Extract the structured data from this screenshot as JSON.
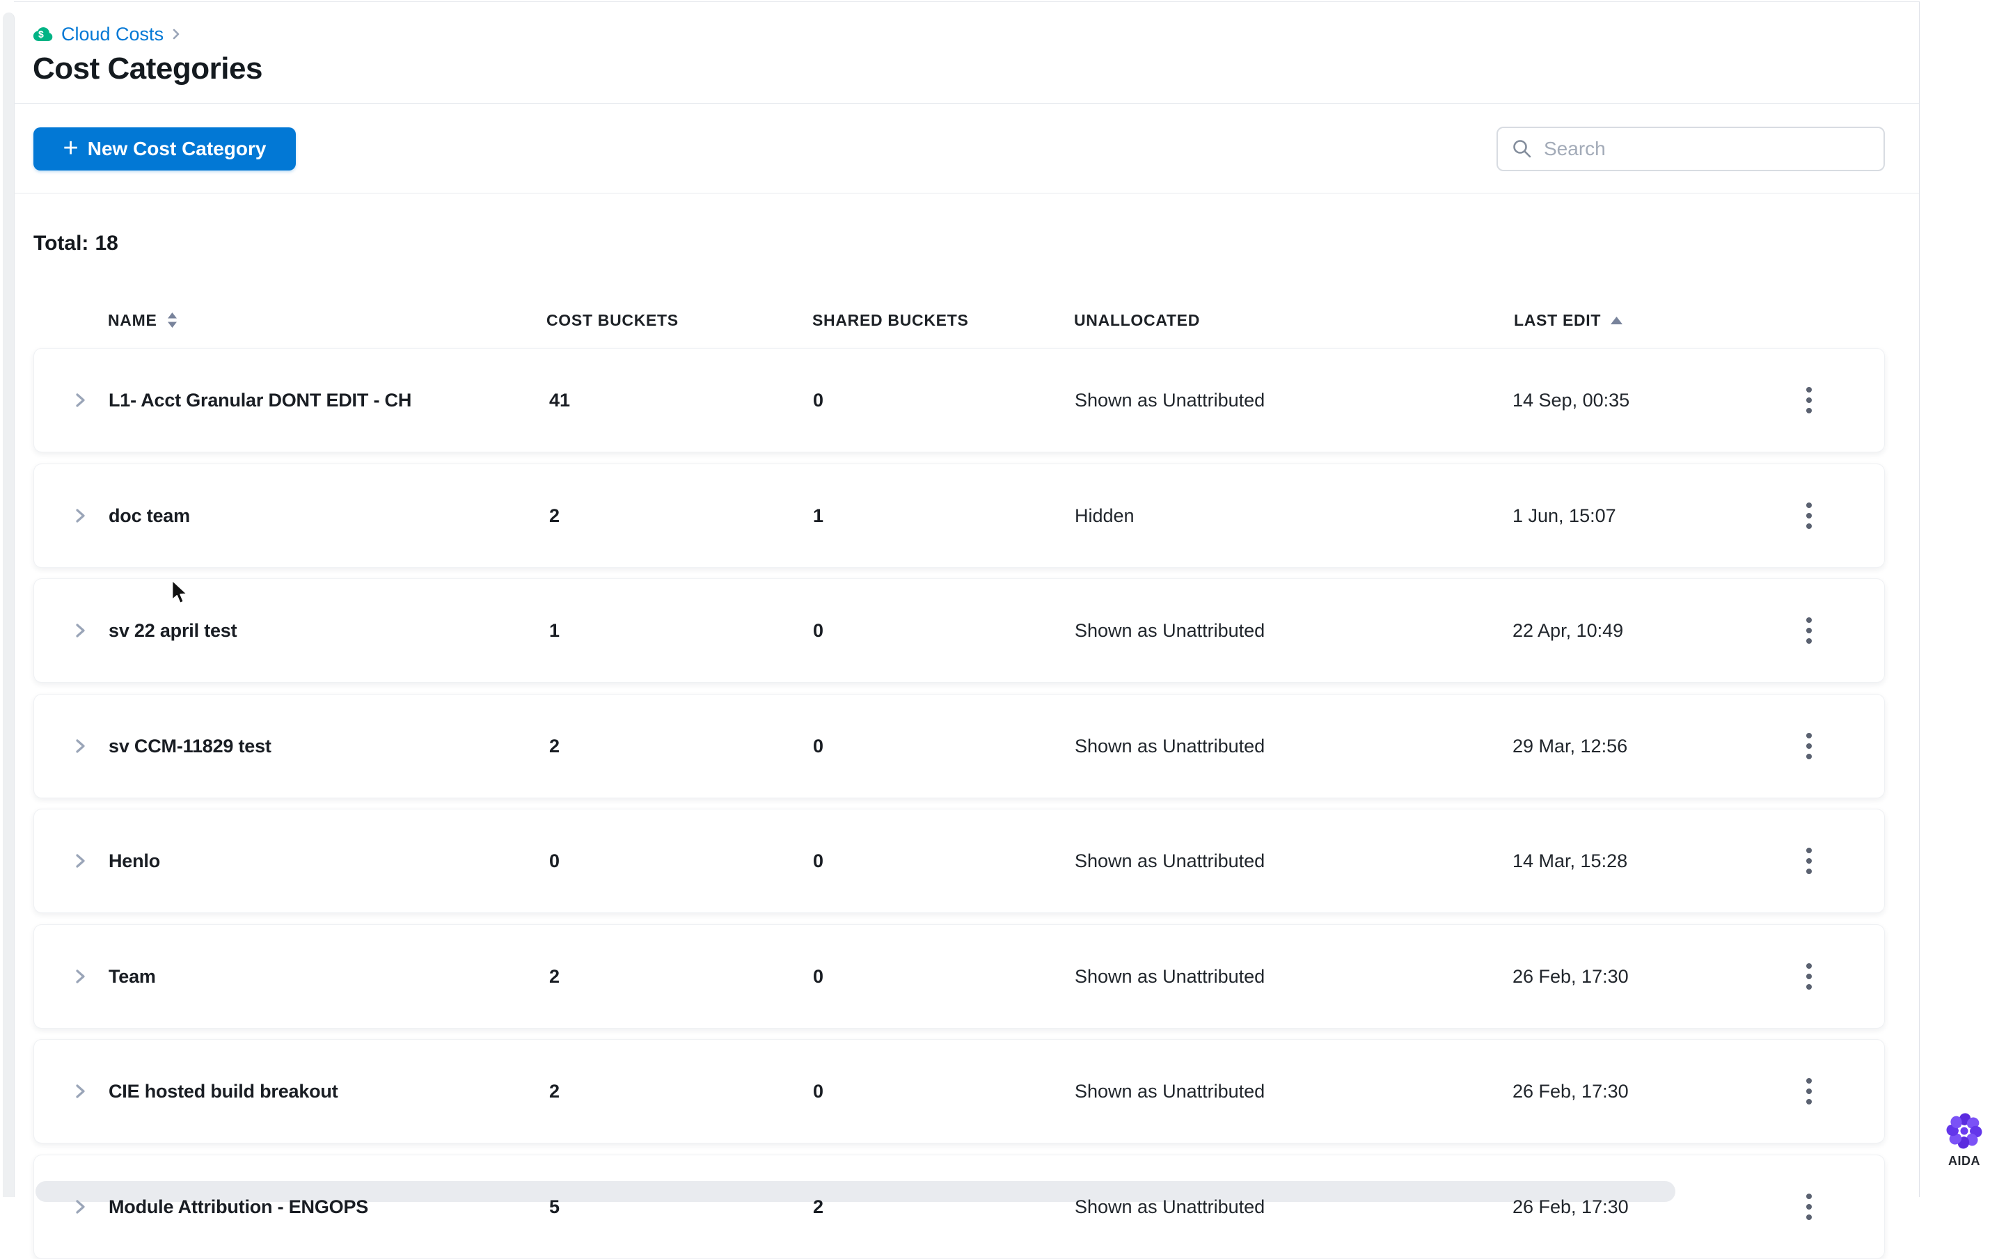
{
  "breadcrumb": {
    "module": "Cloud Costs"
  },
  "page": {
    "title": "Cost Categories",
    "total_label": "Total:",
    "total_count": "18"
  },
  "toolbar": {
    "new_button_plus": "+",
    "new_button_label": "New Cost Category",
    "search_placeholder": "Search",
    "search_value": ""
  },
  "table": {
    "columns": [
      {
        "label": "NAME",
        "sort": "both"
      },
      {
        "label": "COST BUCKETS",
        "sort": "none"
      },
      {
        "label": "SHARED BUCKETS",
        "sort": "none"
      },
      {
        "label": "UNALLOCATED",
        "sort": "none"
      },
      {
        "label": "LAST EDIT",
        "sort": "asc"
      }
    ],
    "rows": [
      {
        "name": "L1- Acct Granular DONT EDIT - CH",
        "cost_buckets": "41",
        "shared_buckets": "0",
        "unallocated": "Shown as Unattributed",
        "last_edit": "14 Sep, 00:35"
      },
      {
        "name": "doc team",
        "cost_buckets": "2",
        "shared_buckets": "1",
        "unallocated": "Hidden",
        "last_edit": "1 Jun, 15:07"
      },
      {
        "name": "sv 22 april test",
        "cost_buckets": "1",
        "shared_buckets": "0",
        "unallocated": "Shown as Unattributed",
        "last_edit": "22 Apr, 10:49"
      },
      {
        "name": "sv CCM-11829 test",
        "cost_buckets": "2",
        "shared_buckets": "0",
        "unallocated": "Shown as Unattributed",
        "last_edit": "29 Mar, 12:56"
      },
      {
        "name": "Henlo",
        "cost_buckets": "0",
        "shared_buckets": "0",
        "unallocated": "Shown as Unattributed",
        "last_edit": "14 Mar, 15:28"
      },
      {
        "name": "Team",
        "cost_buckets": "2",
        "shared_buckets": "0",
        "unallocated": "Shown as Unattributed",
        "last_edit": "26 Feb, 17:30"
      },
      {
        "name": "CIE hosted build breakout",
        "cost_buckets": "2",
        "shared_buckets": "0",
        "unallocated": "Shown as Unattributed",
        "last_edit": "26 Feb, 17:30"
      },
      {
        "name": "Module Attribution - ENGOPS",
        "cost_buckets": "5",
        "shared_buckets": "2",
        "unallocated": "Shown as Unattributed",
        "last_edit": "26 Feb, 17:30"
      }
    ]
  },
  "aida": {
    "label": "AIDA"
  },
  "colors": {
    "accent_blue": "#0278d5",
    "aida_purple": "#6d3ff2",
    "ccm_green": "#02b385",
    "icon_gray": "#9aa5b8",
    "header_text": "#1d2126",
    "hairline": "#e4e7ec"
  }
}
